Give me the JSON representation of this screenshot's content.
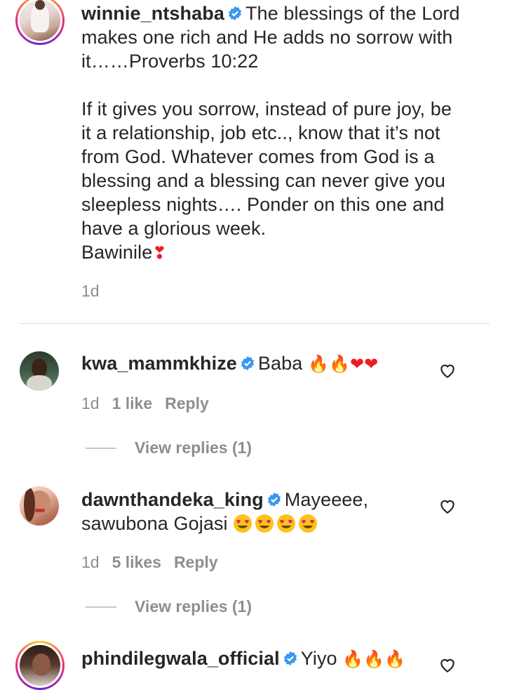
{
  "post": {
    "username": "winnie_ntshaba",
    "lines": [
      "The blessings of the Lord",
      "makes one rich and He adds no sorrow with",
      "it……Proverbs 10:22",
      "",
      "If it gives you sorrow, instead of pure joy, be",
      "it a relationship, job etc.., know that it’s not",
      "from God. Whatever comes from God is a",
      "blessing and a blessing can never give you",
      "sleepless nights…. Ponder on this one and",
      "have a glorious week.",
      "Bawinile"
    ],
    "time": "1d"
  },
  "comments": [
    {
      "username": "kwa_mammkhize",
      "text": "Baba",
      "emojis": "🔥🔥❤️❤️",
      "time": "1d",
      "likes": "1 like",
      "reply": "Reply",
      "view_replies": "View replies (1)"
    },
    {
      "username": "dawnthandeka_king",
      "text_line1": "Mayeeee,",
      "text_line2": "sawubona Gojasi",
      "emojis": "😍😍😍😍",
      "time": "1d",
      "likes": "5 likes",
      "reply": "Reply",
      "view_replies": "View replies (1)"
    },
    {
      "username": "phindilegwala_official",
      "text": "Yiyo",
      "emojis": "🔥🔥🔥"
    }
  ],
  "colors": {
    "verified": "#3897f0",
    "muted": "#8e8e8e",
    "text": "#262626"
  }
}
